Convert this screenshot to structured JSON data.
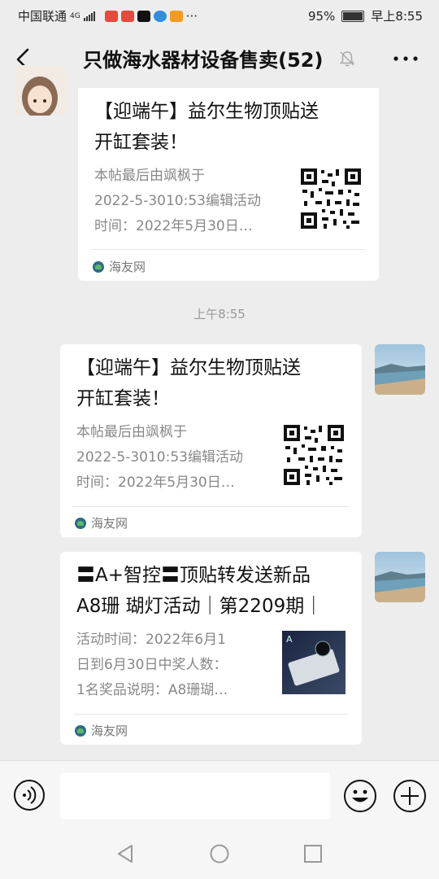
{
  "status_bar": {
    "carrier": "中国联通",
    "network": "4G",
    "battery": "95%",
    "time": "早上8:55",
    "overflow": "···"
  },
  "chat": {
    "title": "只做海水器材设备售卖(52)"
  },
  "messages": [
    {
      "side": "left",
      "title": "【迎端午】益尔生物顶贴送开缸套装！",
      "title_lines": [
        "【迎端午】益尔生物顶贴送",
        "开缸套装！"
      ],
      "desc_lines": [
        "本帖最后由飒枫于",
        "2022-5-3010:53编辑活动",
        "时间：2022年5月30日…"
      ],
      "source": "海友网",
      "thumb": "qr-code"
    },
    {
      "side": "right",
      "title_lines": [
        "【迎端午】益尔生物顶贴送",
        "开缸套装！"
      ],
      "desc_lines": [
        "本帖最后由飒枫于",
        "2022-5-3010:53编辑活动",
        "时间：2022年5月30日…"
      ],
      "source": "海友网",
      "thumb": "qr-code"
    },
    {
      "side": "right",
      "title_lines": [
        "〓A+智控〓顶贴转发送新品",
        "A8珊 瑚灯活动｜第2209期｜"
      ],
      "desc_lines": [
        "活动时间：2022年6月1",
        "日到6月30日中奖人数：",
        "1名奖品说明：A8珊瑚…"
      ],
      "source": "海友网",
      "thumb": "product-image"
    }
  ],
  "timestamp": "上午8:55",
  "input": {
    "value": ""
  },
  "icons": {
    "back": "chevron-left-icon",
    "mute": "bell-off-icon",
    "more": "more-dots-icon",
    "voice": "voice-icon",
    "emoji": "emoji-icon",
    "plus": "plus-circle-icon",
    "nav_back": "triangle-back-icon",
    "nav_home": "circle-home-icon",
    "nav_recent": "square-recent-icon"
  }
}
